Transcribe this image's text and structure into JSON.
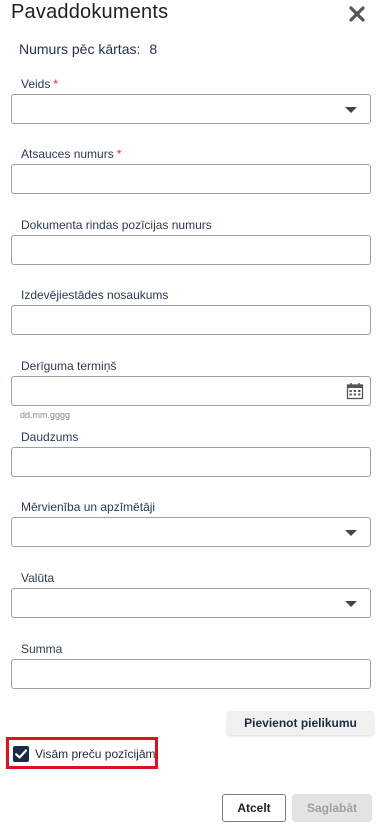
{
  "dialog": {
    "title": "Pavaddokuments",
    "counter_label": "Numurs pēc kārtas:",
    "counter_value": "8"
  },
  "fields": {
    "type": {
      "label": "Veids",
      "required_mark": "*",
      "value": ""
    },
    "reference_number": {
      "label": "Atsauces numurs",
      "required_mark": "*",
      "value": ""
    },
    "line_position_number": {
      "label": "Dokumenta rindas pozīcijas numurs",
      "value": ""
    },
    "issuer_name": {
      "label": "Izdevējiestādes nosaukums",
      "value": ""
    },
    "validity_date": {
      "label": "Derīguma termiņš",
      "value": "",
      "hint": "dd.mm.gggg"
    },
    "quantity": {
      "label": "Daudzums",
      "value": ""
    },
    "unit": {
      "label": "Mērvienība un apzīmētāji",
      "value": ""
    },
    "currency": {
      "label": "Valūta",
      "value": ""
    },
    "amount": {
      "label": "Summa",
      "value": ""
    }
  },
  "attach_button": "Pievienot pielikumu",
  "all_items_checkbox": {
    "label": "Visām preču pozīcijām",
    "checked": true
  },
  "footer": {
    "cancel": "Atcelt",
    "save": "Saglabāt"
  },
  "icons": {
    "close": "close-icon",
    "dropdown": "chevron-down-icon",
    "calendar": "calendar-icon",
    "check": "checkmark-icon"
  },
  "colors": {
    "accent_dark": "#1c2a4a",
    "required": "#d32f2f",
    "highlight_border": "#e0101a",
    "disabled_button": "#e3e3e3"
  }
}
